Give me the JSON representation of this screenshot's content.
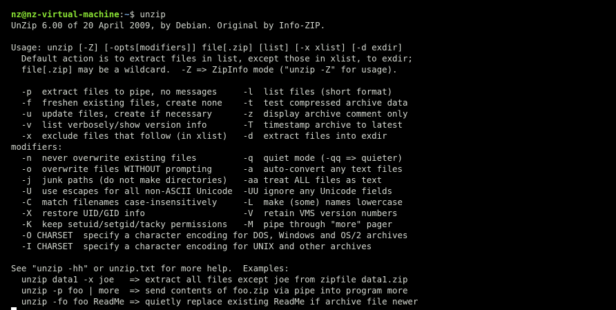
{
  "prompt": {
    "user_host": "nz@nz-virtual-machine",
    "separator": ":",
    "path": "~",
    "symbol": "$ ",
    "command": "unzip"
  },
  "output_lines": [
    "UnZip 6.00 of 20 April 2009, by Debian. Original by Info-ZIP.",
    "",
    "Usage: unzip [-Z] [-opts[modifiers]] file[.zip] [list] [-x xlist] [-d exdir]",
    "  Default action is to extract files in list, except those in xlist, to exdir;",
    "  file[.zip] may be a wildcard.  -Z => ZipInfo mode (\"unzip -Z\" for usage).",
    "",
    "  -p  extract files to pipe, no messages     -l  list files (short format)",
    "  -f  freshen existing files, create none    -t  test compressed archive data",
    "  -u  update files, create if necessary      -z  display archive comment only",
    "  -v  list verbosely/show version info       -T  timestamp archive to latest",
    "  -x  exclude files that follow (in xlist)   -d  extract files into exdir",
    "modifiers:",
    "  -n  never overwrite existing files         -q  quiet mode (-qq => quieter)",
    "  -o  overwrite files WITHOUT prompting      -a  auto-convert any text files",
    "  -j  junk paths (do not make directories)   -aa treat ALL files as text",
    "  -U  use escapes for all non-ASCII Unicode  -UU ignore any Unicode fields",
    "  -C  match filenames case-insensitively     -L  make (some) names lowercase",
    "  -X  restore UID/GID info                   -V  retain VMS version numbers",
    "  -K  keep setuid/setgid/tacky permissions   -M  pipe through \"more\" pager",
    "  -O CHARSET  specify a character encoding for DOS, Windows and OS/2 archives",
    "  -I CHARSET  specify a character encoding for UNIX and other archives",
    "",
    "See \"unzip -hh\" or unzip.txt for more help.  Examples:",
    "  unzip data1 -x joe   => extract all files except joe from zipfile data1.zip",
    "  unzip -p foo | more  => send contents of foo.zip via pipe into program more",
    "  unzip -fo foo ReadMe => quietly replace existing ReadMe if archive file newer"
  ],
  "colors": {
    "background": "#000000",
    "text": "#d3d7cf",
    "user_host": "#8ae234",
    "path": "#729fcf",
    "cursor": "#ffffff"
  }
}
